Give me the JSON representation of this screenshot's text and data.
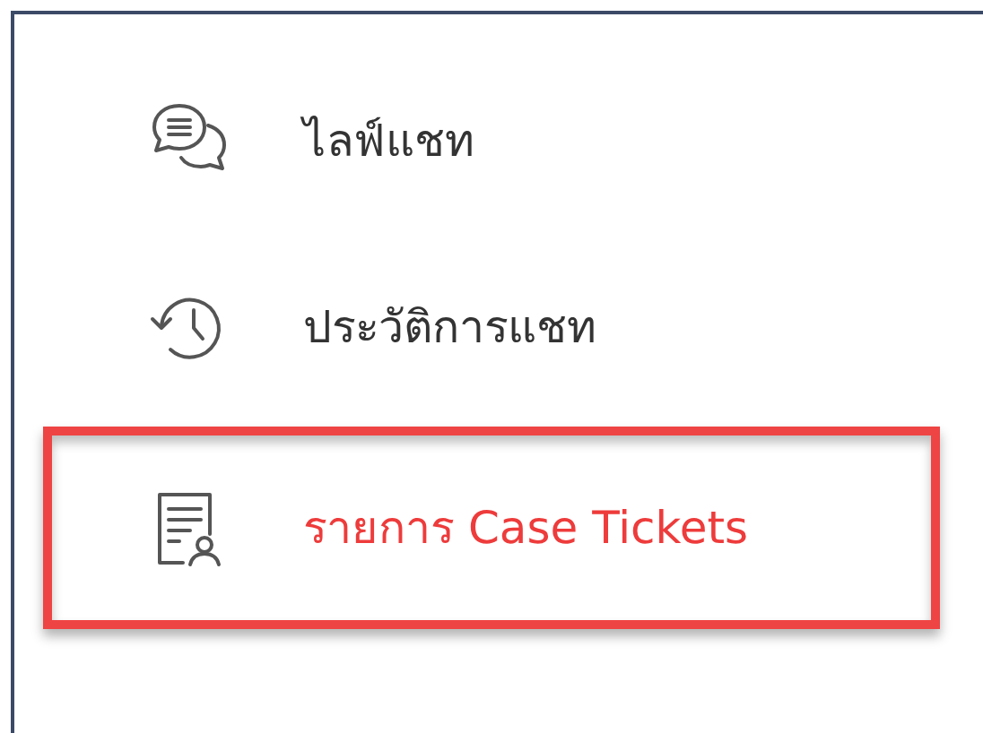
{
  "menu": {
    "items": [
      {
        "kind": "chat",
        "label": "ไลฟ์แชท",
        "selected": false
      },
      {
        "kind": "history",
        "label": "ประวัติการแชท",
        "selected": false
      },
      {
        "kind": "ticket",
        "label": "รายการ Case Tickets",
        "selected": true
      }
    ]
  }
}
